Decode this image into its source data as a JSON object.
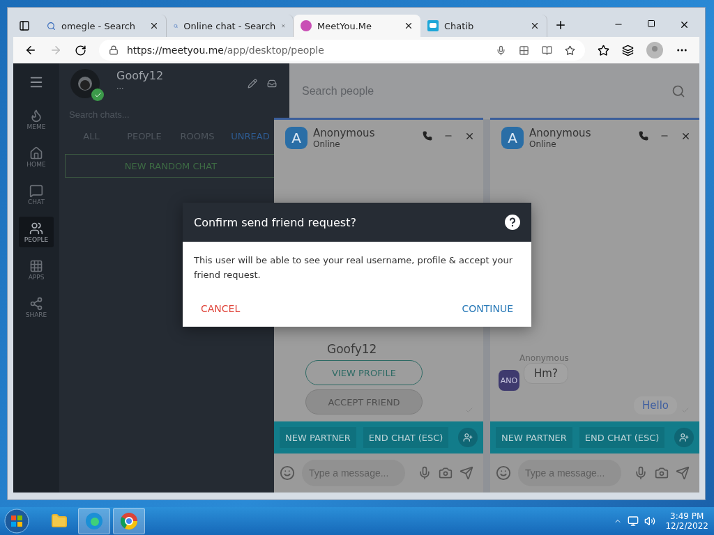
{
  "browser": {
    "tabs": [
      {
        "title": "omegle - Search",
        "selected": false
      },
      {
        "title": "Online chat - Search",
        "selected": false
      },
      {
        "title": "MeetYou.Me",
        "selected": true
      },
      {
        "title": "Chatib",
        "selected": false
      }
    ],
    "url_host": "https://meetyou.me",
    "url_path": "/app/desktop/people"
  },
  "rail": [
    {
      "label": "MEME",
      "selected": false
    },
    {
      "label": "HOME",
      "selected": false
    },
    {
      "label": "CHAT",
      "selected": false
    },
    {
      "label": "PEOPLE",
      "selected": true
    },
    {
      "label": "APPS",
      "selected": false
    },
    {
      "label": "SHARE",
      "selected": false
    }
  ],
  "profile": {
    "name": "Goofy12",
    "status": "...",
    "online": true
  },
  "chat_search": {
    "placeholder": "Search chats..."
  },
  "filters": [
    {
      "label": "ALL",
      "selected": false
    },
    {
      "label": "PEOPLE",
      "selected": false
    },
    {
      "label": "ROOMS",
      "selected": false
    },
    {
      "label": "UNREAD",
      "selected": true
    }
  ],
  "new_chat_button": "NEW RANDOM CHAT",
  "people_search": {
    "placeholder": "Search people"
  },
  "chats": [
    {
      "avatar": "A",
      "name": "Anonymous",
      "status": "Online",
      "body": [
        {
          "kind": "profile",
          "name": "Goofy12",
          "view_button": "VIEW PROFILE",
          "friend_button": "ACCEPT FRIEND",
          "disabled": true
        }
      ],
      "buttons": [
        "NEW PARTNER",
        "END CHAT (ESC)"
      ],
      "input_placeholder": "Type a message..."
    },
    {
      "avatar": "A",
      "name": "Anonymous",
      "status": "Online",
      "body": [
        {
          "kind": "incoming",
          "sender": "Anonymous",
          "avatar": "ANO",
          "text": "Hm?"
        },
        {
          "kind": "outgoing",
          "text": "Hello"
        }
      ],
      "buttons": [
        "NEW PARTNER",
        "END CHAT (ESC)"
      ],
      "input_placeholder": "Type a message..."
    }
  ],
  "dialog": {
    "title": "Confirm send friend request?",
    "body": "This user will be able to see your real username, profile & accept your friend request.",
    "cancel": "CANCEL",
    "continue": "CONTINUE"
  },
  "taskbar": {
    "time": "3:49 PM",
    "date": "12/2/2022"
  }
}
